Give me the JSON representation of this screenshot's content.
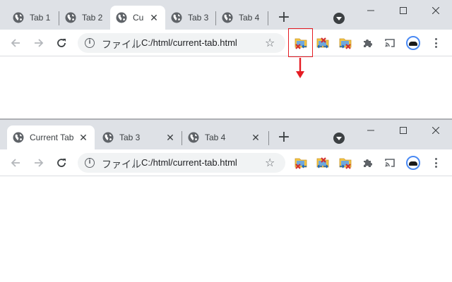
{
  "window1": {
    "tabs": [
      {
        "title": "Tab 1",
        "active": false
      },
      {
        "title": "Tab 2",
        "active": false
      },
      {
        "title": "Cu",
        "active": true
      },
      {
        "title": "Tab 3",
        "active": false
      },
      {
        "title": "Tab 4",
        "active": false
      }
    ],
    "omnibox": {
      "site_label": "ファイル",
      "url": "C:/html/current-tab.html"
    }
  },
  "window2": {
    "tabs": [
      {
        "title": "Current Tab",
        "active": true
      },
      {
        "title": "Tab 3",
        "active": false
      },
      {
        "title": "Tab 4",
        "active": false
      }
    ],
    "omnibox": {
      "site_label": "ファイル",
      "url": "C:/html/current-tab.html"
    }
  },
  "colors": {
    "highlight": "#e51c23",
    "tabstrip": "#dee1e6",
    "accent": "#1a73e8"
  },
  "icons": {
    "tab_favicon": "globe-icon",
    "extensions": [
      "close-current-tab-extension-icon",
      "close-other-tabs-extension-icon",
      "close-tabs-right-extension-icon"
    ],
    "toolbar": [
      "back-arrow-icon",
      "forward-arrow-icon",
      "reload-icon",
      "star-icon",
      "puzzle-icon",
      "cast-icon",
      "kebab-menu-icon"
    ]
  }
}
